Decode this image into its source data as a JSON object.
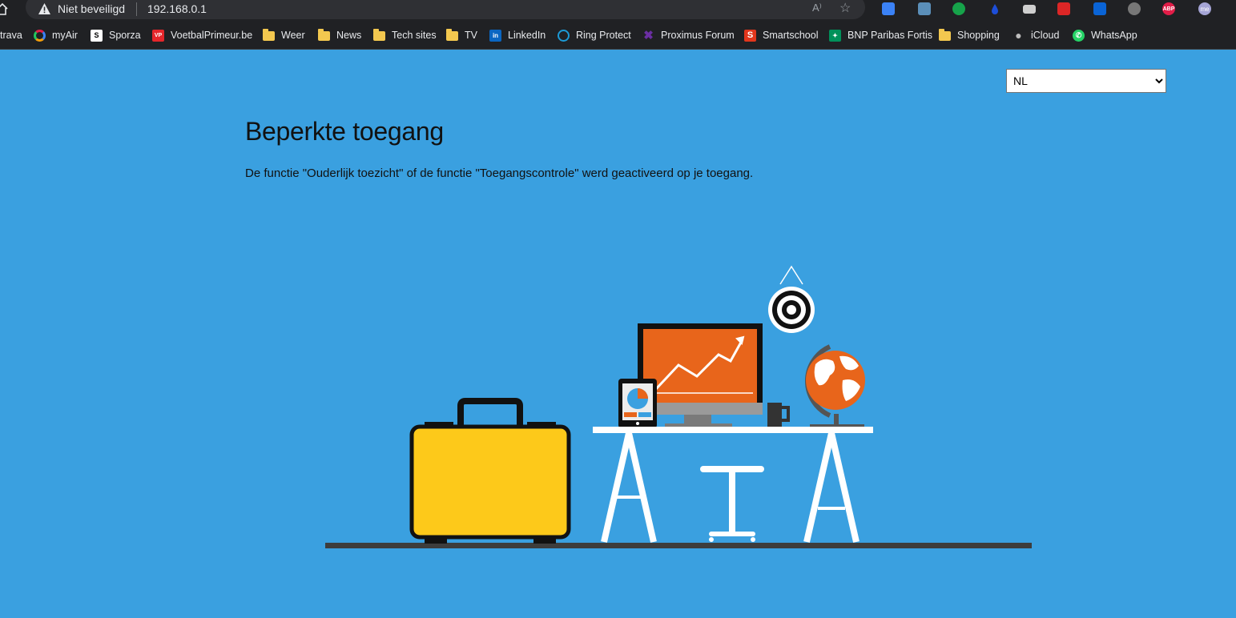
{
  "browser": {
    "security_label": "Niet beveiligd",
    "url": "192.168.0.1",
    "read_aloud_glyph": "A⁾",
    "extensions": [
      {
        "name": "download-extension",
        "color": "#3b82f6"
      },
      {
        "name": "camera-extension",
        "color": "#5b8fb9"
      },
      {
        "name": "sync-extension",
        "color": "#16a34a"
      },
      {
        "name": "drop-extension",
        "color": "#1d4ed8"
      },
      {
        "name": "mail-extension",
        "color": "#cfcfcf"
      },
      {
        "name": "shield-extension",
        "color": "#dc2626"
      },
      {
        "name": "outlook-extension",
        "color": "#0a64d6"
      },
      {
        "name": "spy-extension",
        "color": "#777777"
      },
      {
        "name": "abp-extension",
        "color": "#e11d48",
        "label": "ABP"
      },
      {
        "name": "profile-extension",
        "color": "#a5a5d6",
        "label": "me"
      }
    ]
  },
  "bookmarks": [
    {
      "label": "trava",
      "icon": "none"
    },
    {
      "label": "myAir",
      "icon": "ring-icon"
    },
    {
      "label": "Sporza",
      "icon": "sporza-icon"
    },
    {
      "label": "VoetbalPrimeur.be",
      "icon": "vp-icon"
    },
    {
      "label": "Weer",
      "icon": "folder-icon"
    },
    {
      "label": "News",
      "icon": "folder-icon"
    },
    {
      "label": "Tech sites",
      "icon": "folder-icon"
    },
    {
      "label": "TV",
      "icon": "folder-icon"
    },
    {
      "label": "LinkedIn",
      "icon": "linkedin-icon"
    },
    {
      "label": "Ring Protect",
      "icon": "ring-protect-icon"
    },
    {
      "label": "Proximus Forum",
      "icon": "proximus-icon"
    },
    {
      "label": "Smartschool",
      "icon": "smartschool-icon"
    },
    {
      "label": "BNP Paribas Fortis",
      "icon": "bnp-icon"
    },
    {
      "label": "Shopping",
      "icon": "folder-icon"
    },
    {
      "label": "iCloud",
      "icon": "apple-icon"
    },
    {
      "label": "WhatsApp",
      "icon": "whatsapp-icon"
    }
  ],
  "page": {
    "language": {
      "selected": "NL"
    },
    "title": "Beperkte toegang",
    "description": "De functie \"Ouderlijk toezicht\" of de functie \"Toegangscontrole\" werd geactiveerd op je toegang."
  },
  "colors": {
    "background": "#3aa0e0",
    "suitcase": "#fdc91a",
    "monitor": "#e8651b",
    "desk": "#ffffff"
  }
}
